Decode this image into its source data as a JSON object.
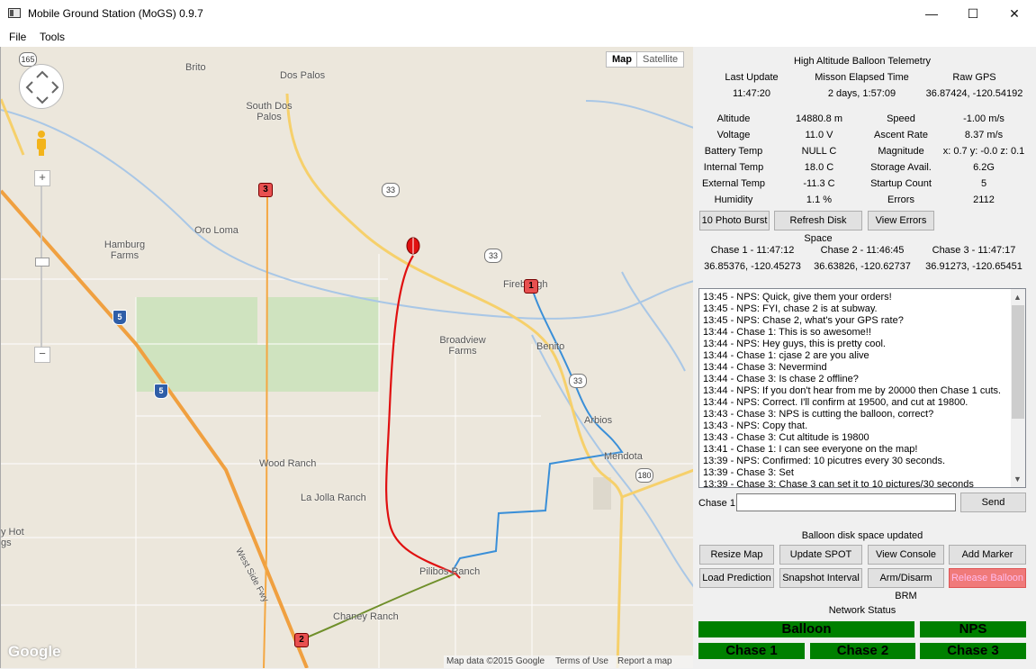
{
  "window": {
    "title": "Mobile Ground Station (MoGS) 0.9.7",
    "controls": {
      "minimize": "—",
      "maximize": "☐",
      "close": "✕"
    }
  },
  "menu": [
    "File",
    "Tools"
  ],
  "map": {
    "type_buttons": [
      "Map",
      "Satellite"
    ],
    "zoom_in": "+",
    "zoom_out": "−",
    "places": [
      "Brito",
      "Dos Palos",
      "South Dos Palos",
      "Hamburg Farms",
      "Oro Loma",
      "Firebaugh",
      "Broadview Farms",
      "Benito",
      "Arbios",
      "Mendota",
      "Wood Ranch",
      "La Jolla Ranch",
      "Pilibos Ranch",
      "Chaney Ranch",
      "y Hot gs",
      "West Side Fwy"
    ],
    "route_shields": [
      "165",
      "33",
      "33",
      "33",
      "180"
    ],
    "interstate_shields": [
      "5",
      "5"
    ],
    "markers": [
      "1",
      "2",
      "3"
    ],
    "google_logo": "Google",
    "footer": [
      "Map data ©2015 Google",
      "Terms of Use",
      "Report a map error"
    ]
  },
  "telemetry": {
    "title": "High Altitude Balloon Telemetry",
    "header": {
      "last_update_label": "Last Update",
      "last_update": "11:47:20",
      "elapsed_label": "Misson Elapsed Time",
      "elapsed": "2 days, 1:57:09",
      "gps_label": "Raw GPS",
      "gps": "36.87424, -120.54192"
    },
    "left": [
      {
        "label": "Altitude",
        "value": "14880.8 m"
      },
      {
        "label": "Voltage",
        "value": "11.0 V"
      },
      {
        "label": "Battery Temp",
        "value": "NULL C"
      },
      {
        "label": "Internal Temp",
        "value": "18.0 C"
      },
      {
        "label": "External Temp",
        "value": "-11.3 C"
      },
      {
        "label": "Humidity",
        "value": "1.1 %"
      }
    ],
    "right": [
      {
        "label": "Speed",
        "value": "-1.00 m/s"
      },
      {
        "label": "Ascent Rate",
        "value": "8.37 m/s"
      },
      {
        "label": "Magnitude",
        "value": "x: 0.7 y: -0.0 z: 0.1"
      },
      {
        "label": "Storage Avail.",
        "value": "6.2G"
      },
      {
        "label": "Startup Count",
        "value": "5"
      },
      {
        "label": "Errors",
        "value": "2112"
      }
    ],
    "buttons": [
      "10 Photo Burst",
      "Refresh Disk Space",
      "View Errors"
    ]
  },
  "chase": [
    {
      "title": "Chase 1 - 11:47:12",
      "pos": "36.85376, -120.45273"
    },
    {
      "title": "Chase 2 - 11:46:45",
      "pos": "36.63826, -120.62737"
    },
    {
      "title": "Chase 3 - 11:47:17",
      "pos": "36.91273, -120.65451"
    }
  ],
  "console": [
    "13:45 - NPS: Quick, give them your orders!",
    "13:45 - NPS: FYI, chase 2 is at subway.",
    "13:45 - NPS: Chase 2, what's your GPS rate?",
    "13:44 - Chase 1: This is so awesome!!",
    "13:44 - NPS: Hey guys, this is pretty cool.",
    "13:44 - Chase 1: cjase 2 are you alive",
    "13:44 - Chase 3: Nevermind",
    "13:44 - Chase 3: Is chase 2 offline?",
    "13:44 - NPS: If you don't hear from me by 20000 then Chase 1 cuts.",
    "13:44 - NPS: Correct. I'll confirm at 19500, and cut at 19800.",
    "13:43 - Chase 3: NPS is cutting the balloon, correct?",
    "13:43 - NPS: Copy that.",
    "13:43 - Chase 3: Cut altitude is 19800",
    "13:41 - Chase 1: I can see everyone on the map!",
    "13:39 - NPS: Confirmed: 10 picutres every 30 seconds.",
    "13:39 - Chase 3: Set",
    "13:39 - Chase 3: Chase 3 can set it to 10 pictures/30 seconds"
  ],
  "chat": {
    "label": "Chase 1",
    "value": "",
    "send": "Send"
  },
  "status_msg": "Balloon disk space updated",
  "actions": [
    "Resize Map",
    "Update SPOT",
    "View Console",
    "Add Marker",
    "Load Prediction",
    "Snapshot Interval",
    "Arm/Disarm BRM",
    "Release Balloon"
  ],
  "network": {
    "title": "Network Status",
    "items": [
      "Balloon",
      "NPS",
      "Chase 1",
      "Chase 2",
      "Chase 3"
    ],
    "color": "#008000"
  }
}
